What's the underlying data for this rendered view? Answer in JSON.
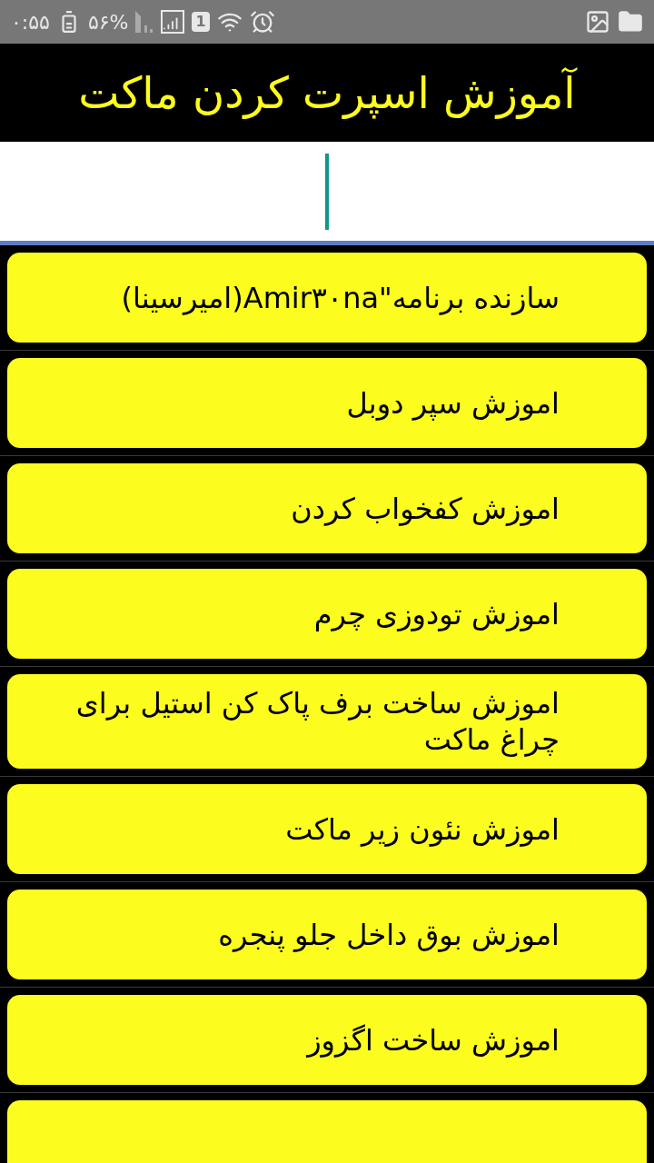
{
  "status_bar": {
    "time": "۰:۵۵",
    "battery": "۵۶%",
    "sim": "1"
  },
  "header": {
    "title": "آموزش اسپرت کردن ماکت"
  },
  "items": [
    {
      "label": "سازنده برنامه\"Amir۳۰na(امیرسینا)"
    },
    {
      "label": "اموزش سپر دوبل"
    },
    {
      "label": "اموزش کفخواب کردن"
    },
    {
      "label": "اموزش تودوزی چرم"
    },
    {
      "label": "اموزش ساخت برف پاک کن استیل برای چراغ ماکت"
    },
    {
      "label": "اموزش نئون زیر ماکت"
    },
    {
      "label": "اموزش بوق داخل جلو پنجره"
    },
    {
      "label": "اموزش ساخت اگزوز"
    }
  ]
}
